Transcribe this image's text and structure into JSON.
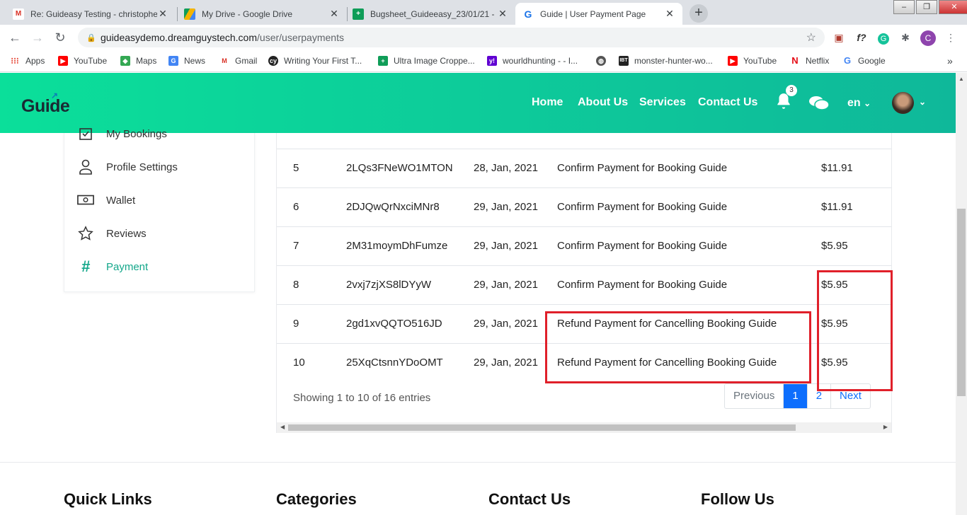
{
  "browser": {
    "tabs": [
      {
        "title": "Re: Guideasy Testing - christophe",
        "icon": "gmail-icon"
      },
      {
        "title": "My Drive - Google Drive",
        "icon": "drive-icon"
      },
      {
        "title": "Bugsheet_Guideeasy_23/01/21 -",
        "icon": "sheets-icon"
      },
      {
        "title": "Guide | User Payment Page",
        "icon": "guide-icon"
      }
    ],
    "url_domain": "guideasydemo.dreamguystech.com",
    "url_path": "/user/userpayments",
    "profile_initial": "C",
    "bookmarks": [
      {
        "label": "Apps"
      },
      {
        "label": "YouTube"
      },
      {
        "label": "Maps"
      },
      {
        "label": "News"
      },
      {
        "label": "Gmail"
      },
      {
        "label": "Writing Your First T..."
      },
      {
        "label": "Ultra Image Croppe..."
      },
      {
        "label": "wourldhunting - - I..."
      },
      {
        "label": ""
      },
      {
        "label": "monster-hunter-wo..."
      },
      {
        "label": "YouTube"
      },
      {
        "label": "Netflix"
      },
      {
        "label": "Google"
      }
    ]
  },
  "site": {
    "logo": "Guide",
    "nav": [
      "Home",
      "About Us",
      "Services",
      "Contact Us"
    ],
    "notification_count": "3",
    "language": "en"
  },
  "sidebar": {
    "items": [
      {
        "label": "My Bookings",
        "icon": "booking-check-icon"
      },
      {
        "label": "Profile Settings",
        "icon": "user-icon"
      },
      {
        "label": "Wallet",
        "icon": "wallet-icon"
      },
      {
        "label": "Reviews",
        "icon": "star-icon"
      },
      {
        "label": "Payment",
        "icon": "hash-icon"
      }
    ]
  },
  "table": {
    "rows": [
      {
        "no": "5",
        "id": "2LQs3FNeWO1MTON",
        "date": "28, Jan, 2021",
        "desc": "Confirm Payment for Booking Guide",
        "amount": "$11.91"
      },
      {
        "no": "6",
        "id": "2DJQwQrNxciMNr8",
        "date": "29, Jan, 2021",
        "desc": "Confirm Payment for Booking Guide",
        "amount": "$11.91"
      },
      {
        "no": "7",
        "id": "2M31moymDhFumze",
        "date": "29, Jan, 2021",
        "desc": "Confirm Payment for Booking Guide",
        "amount": "$5.95"
      },
      {
        "no": "8",
        "id": "2vxj7zjXS8lDYyW",
        "date": "29, Jan, 2021",
        "desc": "Confirm Payment for Booking Guide",
        "amount": "$5.95"
      },
      {
        "no": "9",
        "id": "2gd1xvQQTO516JD",
        "date": "29, Jan, 2021",
        "desc": "Refund Payment for Cancelling Booking Guide",
        "amount": "$5.95"
      },
      {
        "no": "10",
        "id": "25XqCtsnnYDoOMT",
        "date": "29, Jan, 2021",
        "desc": "Refund Payment for Cancelling Booking Guide",
        "amount": "$5.95"
      }
    ],
    "showing": "Showing 1 to 10 of 16 entries",
    "pager": {
      "prev": "Previous",
      "pages": [
        "1",
        "2"
      ],
      "next": "Next"
    }
  },
  "footer": {
    "headings": [
      "Quick Links",
      "Categories",
      "Contact Us",
      "Follow Us"
    ]
  },
  "colors": {
    "header_start": "#0bdf9a",
    "header_end": "#0fb89a",
    "active_sidebar": "#13a78a",
    "highlight": "#e0202a",
    "pager_active": "#0d6efd"
  }
}
